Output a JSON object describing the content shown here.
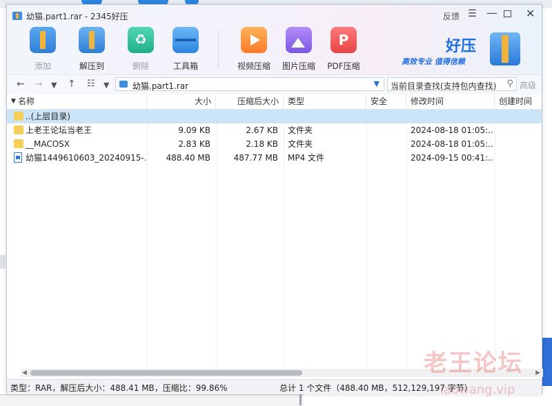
{
  "window": {
    "title": "幼猫.part1.rar - 2345好压"
  },
  "window_controls": {
    "feedback": "反馈",
    "menu": "☰",
    "minimize": "—",
    "close": "✕"
  },
  "toolbar": {
    "add": "添加",
    "extract": "解压到",
    "delete": "删除",
    "toolbox": "工具箱",
    "video_compress": "视频压缩",
    "image_compress": "图片压缩",
    "pdf_compress": "PDF压缩"
  },
  "brand": {
    "name": "好压",
    "slogan": "高效专业  值得信赖"
  },
  "address": {
    "path": "幼猫.part1.rar",
    "search_placeholder": "当前目录查找(支持包内查找)",
    "advanced": "高级"
  },
  "columns": {
    "name": "名称",
    "size": "大小",
    "packed": "压缩后大小",
    "type": "类型",
    "security": "安全",
    "modified": "修改时间",
    "created": "创建时间"
  },
  "rows": [
    {
      "name": "..(上层目录)",
      "size": "",
      "packed": "",
      "type": "",
      "modified": "",
      "icon": "folder-icon",
      "selected": true
    },
    {
      "name": "上老王论坛当老王",
      "size": "9.09 KB",
      "packed": "2.67 KB",
      "type": "文件夹",
      "modified": "2024-08-18 01:05:...",
      "icon": "folder-icon"
    },
    {
      "name": "__MACOSX",
      "size": "2.83 KB",
      "packed": "2.18 KB",
      "type": "文件夹",
      "modified": "2024-08-18 01:05:...",
      "icon": "folder-icon"
    },
    {
      "name": "幼猫1449610603_20240915-...",
      "size": "488.40 MB",
      "packed": "487.77 MB",
      "type": "MP4 文件",
      "modified": "2024-09-15 00:41:...",
      "icon": "video-file-icon"
    }
  ],
  "status": {
    "left": "类型：RAR，解压后大小：488.41 MB，压缩比：99.86%",
    "right": "总计 1 个文件（488.40 MB，512,129,197 字节）"
  },
  "watermark": {
    "text": "老王论坛",
    "url": "laowang.vip"
  }
}
